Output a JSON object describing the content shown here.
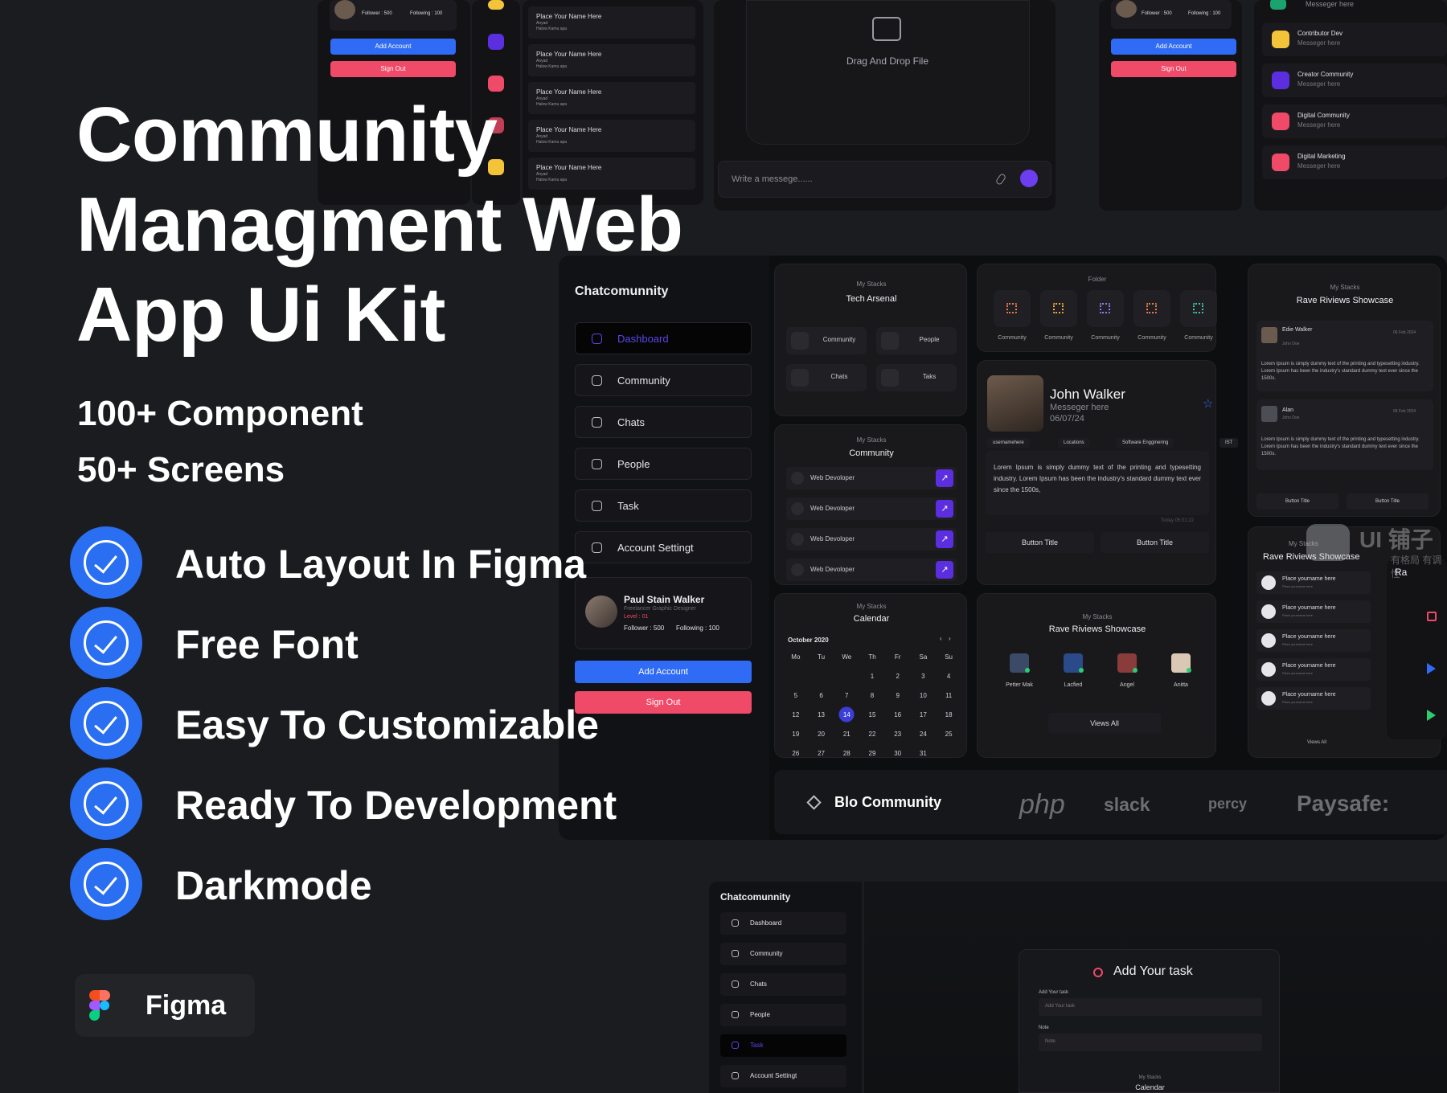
{
  "hero": {
    "title_line1": "Community",
    "title_line2": "Managment Web",
    "title_line3": "App Ui Kit",
    "sub1": "100+ Component",
    "sub2": "50+ Screens",
    "features": [
      "Auto Layout In Figma",
      "Free Font",
      "Easy To Customizable",
      "Ready To Development",
      "Darkmode"
    ],
    "figma_label": "Figma"
  },
  "colors": {
    "accent_blue": "#2f6bf5",
    "accent_red": "#ef4a67",
    "accent_purple": "#5b2ee0",
    "bg": "#1b1c1f"
  },
  "top_left_card": {
    "follower": "Follower : 500",
    "following": "Following : 100",
    "add_account": "Add Account",
    "sign_out": "Sign Out"
  },
  "name_list": {
    "items": [
      {
        "name": "Place Your Name Here",
        "sub": "Anyad",
        "sub2": "Halow Kamu apa"
      },
      {
        "name": "Place Your Name Here",
        "sub": "Anyad",
        "sub2": "Halow Kamu apa"
      },
      {
        "name": "Place Your Name Here",
        "sub": "Anyad",
        "sub2": "Halow Kamu apa"
      },
      {
        "name": "Place Your Name Here",
        "sub": "Anyad",
        "sub2": "Halow Kamu apa"
      },
      {
        "name": "Place Your Name Here",
        "sub": "Anyad",
        "sub2": "Halow Kamu apa"
      }
    ]
  },
  "drop": {
    "label": "Drag And Drop File",
    "placeholder": "Write a messege......"
  },
  "top_right_card": {
    "follower": "Follower : 500",
    "following": "Following : 100",
    "add_account": "Add Account",
    "sign_out": "Sign Out"
  },
  "community_list": {
    "top_sub": "Messeger here",
    "items": [
      {
        "title": "Contributor Dev",
        "sub": "Messeger here",
        "color": "#f3c33a"
      },
      {
        "title": "Creator Community",
        "sub": "Messeger here",
        "color": "#5b2ee0"
      },
      {
        "title": "Digital Community",
        "sub": "Messeger here",
        "color": "#ef4a67"
      },
      {
        "title": "Digital Marketing",
        "sub": "Messeger here",
        "color": "#ef4a67"
      }
    ]
  },
  "sidebar": {
    "app_name": "Chatcomunnity",
    "items": [
      "Dashboard",
      "Community",
      "Chats",
      "People",
      "Task",
      "Account Settingt"
    ],
    "profile_name": "Paul Stain Walker",
    "profile_role": "Freelancer Graphic Designer",
    "profile_level": "Level : 01",
    "follower": "Follower : 500",
    "following": "Following : 100",
    "add_account": "Add Account",
    "sign_out": "Sign Out"
  },
  "tech_arsenal": {
    "kicker": "My Stacks",
    "title": "Tech Arsenal",
    "items": [
      "Community",
      "People",
      "Chats",
      "Taks"
    ]
  },
  "folder": {
    "kicker": "Folder",
    "items": [
      "Community",
      "Community",
      "Community",
      "Community",
      "Community"
    ]
  },
  "reviews": {
    "kicker": "My Stacks",
    "title": "Rave Riviews Showcase",
    "r1_name": "Edie Walker",
    "r1_sub": "John Doe",
    "r1_date": "06 Feb 2024",
    "r2_name": "Alan",
    "r2_sub": "John Doe",
    "r2_date": "06 Feb 2024",
    "body": "Lorem Ipsum is simply dummy text of the printing and typesetting industry. Lorem Ipsum has been the industry's standard dummy text ever since the 1500s.",
    "btn": "Button Title"
  },
  "community_stack": {
    "kicker": "My Stacks",
    "title": "Community",
    "items": [
      "Web Devoloper",
      "Web Devoloper",
      "Web Devoloper",
      "Web Devoloper"
    ]
  },
  "john": {
    "name": "John Walker",
    "sub": "Messeger here",
    "date": "06/07/24",
    "tags": [
      "usernamehere",
      "Locations",
      "Software Engginering",
      "IST"
    ],
    "body": "Lorem Ipsum is simply dummy text of the printing and typesetting industry. Lorem Ipsum has been the industry's standard dummy text ever since the 1500s,",
    "time": "Today 05:01:22",
    "btn1": "Button Title",
    "btn2": "Button Title"
  },
  "reviews2": {
    "kicker": "My Stacks",
    "title": "Rave Riviews Showcase",
    "items": [
      "Place yourname here",
      "Place yourname here",
      "Place yourname here",
      "Place yourname here",
      "Place yourname here"
    ],
    "item_sub": "Place yourname here",
    "views": "Views All"
  },
  "calendar": {
    "kicker": "My Stacks",
    "title": "Calendar",
    "month": "October 2020",
    "days": [
      "Mo",
      "Tu",
      "We",
      "Th",
      "Fr",
      "Sa",
      "Su"
    ],
    "weeks": [
      [
        "",
        "",
        "",
        "1",
        "2",
        "3",
        "4"
      ],
      [
        "5",
        "6",
        "7",
        "8",
        "9",
        "10",
        "11"
      ],
      [
        "12",
        "13",
        "14",
        "15",
        "16",
        "17",
        "18"
      ],
      [
        "19",
        "20",
        "21",
        "22",
        "23",
        "24",
        "25"
      ],
      [
        "26",
        "27",
        "28",
        "29",
        "30",
        "31",
        ""
      ]
    ],
    "selected": "14"
  },
  "people_show": {
    "kicker": "My Stacks",
    "title": "Rave Riviews Showcase",
    "people": [
      "Petter Mak",
      "Lacfied",
      "Angel",
      "Anitta"
    ],
    "views": "Views All"
  },
  "logos": {
    "brand": "Blo Community",
    "l1": "php",
    "l2": "slack",
    "l3": "percy",
    "l4": "Paysafe:"
  },
  "watermark": {
    "a": "UI 铺子",
    "b": "有格局 有调性"
  },
  "bottom_sidebar": {
    "app_name": "Chatcomunnity",
    "items": [
      "Dashboard",
      "Community",
      "Chats",
      "People",
      "Task",
      "Account Settingt"
    ]
  },
  "task_modal": {
    "title": "Add Your task",
    "label1": "Add Your task",
    "placeholder1": "Add Your task",
    "label2": "Note",
    "placeholder2": "Note",
    "kicker": "My Stacks",
    "kicker_title": "Calendar"
  }
}
